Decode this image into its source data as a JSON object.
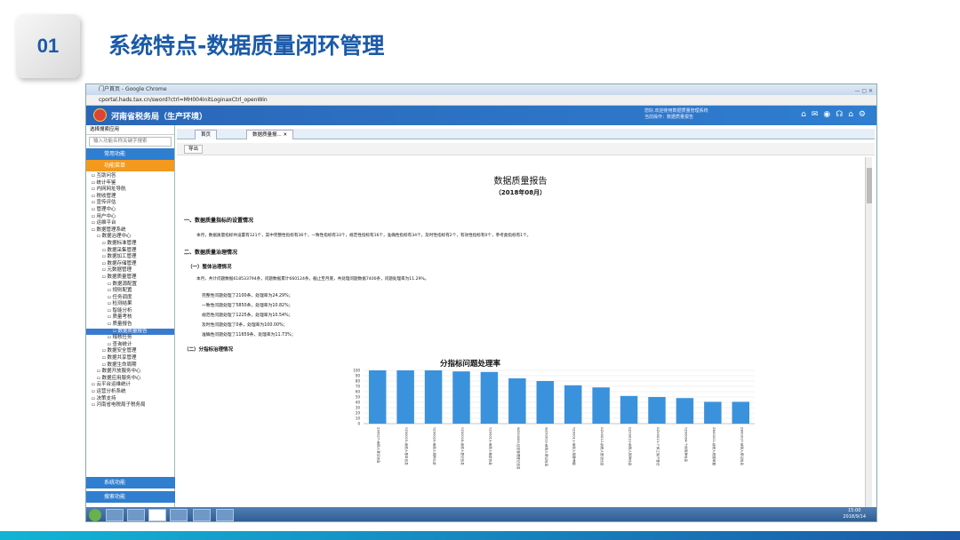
{
  "slide": {
    "number": "01",
    "title": "系统特点-数据质量闭环管理"
  },
  "window": {
    "title": "门户首页 - Google Chrome",
    "address": "cportal.hads.tax.cn/sword?ctrl=MH004InitLoginaxCtrl_openWin"
  },
  "app": {
    "title": "河南省税务局（生产环境）",
    "info_line1": "您好,欢迎使用数据质量管理系统",
    "info_line2": "当前操作：数据质量报告"
  },
  "sidebar": {
    "select": "选择搜索应用",
    "search_placeholder": "输入功能名称关键字搜索",
    "common": "常用功能",
    "orange": "功能菜单",
    "tree": [
      "互助问答",
      "统计年鉴",
      "内网网址导航",
      "税收管理",
      "宣传评估",
      "管理中心",
      "用户中心",
      "运维平台",
      "数据管理系统",
      "数据治理中心",
      "数据标准管理",
      "数据采集管理",
      "数据加工管理",
      "数据存储管理",
      "元数据管理",
      "数据质量管理",
      "数据源配置",
      "规则配置",
      "任务调度",
      "检测结果",
      "智能分析",
      "质量考核",
      "质量报告",
      "数据质量报告",
      "稽核任务",
      "查询统计",
      "数据安全管理",
      "数据共享管理",
      "数据生命周期",
      "数据开放服务中心",
      "数据应用服务中心",
      "云平台运维统计",
      "运营分析系统",
      "决策支持",
      "河南省电税局子税务局"
    ],
    "bottom1": "系统功能",
    "bottom2": "搜索功能"
  },
  "tabs": [
    "首页",
    "数据质量报..."
  ],
  "toolbar": {
    "export": "导出"
  },
  "report": {
    "title": "数据质量报告",
    "period": "（2018年08月）",
    "section1": "一、数据质量指标的设置情况",
    "section1_text": "本月，数据质量指标共设置有121个，其中完整性指标有36个，一致性指标有33个，规范性指标有16个，准确性指标有34个，及时性指标有2个，有效性指标有0个，参考类指标有1个。",
    "section2": "二、数据质量治理情况",
    "sub1": "（一）整体治理情况",
    "sub1_text": "本月，共计问题数据618533794条，问题数据累计660124条，截止至月底，共处理问题数据7400条，问题处理率为11.29%。",
    "lines": [
      "完整性问题处理了2100条，处理率为24.29%；",
      "一致性问题处理了5850条，处理率为10.82%；",
      "规范性问题处理了1225条，处理率为10.54%；",
      "及时性问题处理了0条，处理率为100.00%；",
      "准确性问题处理了11659条，处理率为11.73%；"
    ],
    "sub2": "（二）分指标治理情况"
  },
  "chart_data": {
    "type": "bar",
    "title": "分指标问题处理率",
    "ylim": [
      0,
      100
    ],
    "yticks": [
      0,
      10,
      20,
      30,
      40,
      50,
      60,
      70,
      80,
      90,
      100
    ],
    "categories": [
      "ZX0027-纳税人登记信息",
      "YZX0015-纳税人基本信息",
      "YZX0020-纳税人税种认定",
      "YZX0018-纳税人登记信息",
      "YZX0019-纳税人核定信息",
      "WZX0006-征收管理登记信息",
      "WZX0019-纳税人登记信息",
      "YZX0011-纳税人税费申报",
      "GZX0012-纳税人登记信息",
      "GZX0010-纳税人税种信息",
      "GZX0013-个体工商户登记",
      "YZX0004-个体税种信息",
      "ZBX0021-纳税人税费申报",
      "ZBX0017-纳税人登记信息"
    ],
    "values": [
      100,
      100,
      100,
      98,
      97,
      85,
      80,
      72,
      68,
      52,
      50,
      48,
      41,
      41
    ],
    "color": "#3b92dc"
  },
  "taskbar": {
    "time": "15:00",
    "date": "2018/9/14"
  }
}
